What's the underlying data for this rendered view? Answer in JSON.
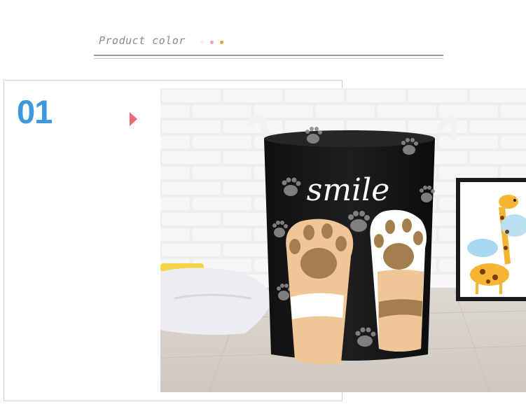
{
  "header": {
    "title": "Product color",
    "dot_colors": [
      "#f1f1f1",
      "#e9a3b8",
      "#e6a13a"
    ]
  },
  "card": {
    "number": "01",
    "number_color": "#3d98df",
    "arrow_color": "#ef6d72"
  },
  "photo": {
    "basket_text": "smile",
    "basket_color": "#181818",
    "paw_color": "#f0c697",
    "pad_color": "#a47f4e",
    "wall_color": "#efefef",
    "floor_color": "#d8d3cc"
  }
}
